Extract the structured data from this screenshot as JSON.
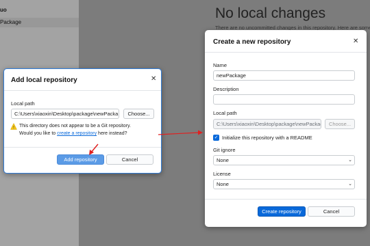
{
  "background": {
    "sidebar_top": "uo",
    "sidebar_item": "Package",
    "main_title": "No local changes",
    "main_subtitle": "There are no uncommitted changes in this repository. Here are some"
  },
  "add_local": {
    "title": "Add local repository",
    "local_path_label": "Local path",
    "local_path_value": "C:\\Users\\xiaoxin\\Desktop\\package\\newPacka",
    "choose_label": "Choose...",
    "warning_line1": "This directory does not appear to be a Git repository.",
    "warning_line2_prefix": "Would you like to ",
    "warning_link": "create a repository",
    "warning_line2_suffix": " here instead?",
    "add_button": "Add repository",
    "cancel_button": "Cancel"
  },
  "create_new": {
    "title": "Create a new repository",
    "name_label": "Name",
    "name_value": "newPackage",
    "description_label": "Description",
    "description_value": "",
    "local_path_label": "Local path",
    "local_path_value": "C:\\Users\\xiaoxin\\Desktop\\package\\newPackage",
    "choose_label": "Choose...",
    "readme_label": "Initialize this repository with a README",
    "readme_checked": true,
    "gitignore_label": "Git ignore",
    "gitignore_value": "None",
    "license_label": "License",
    "license_value": "None",
    "create_button": "Create repository",
    "cancel_button": "Cancel"
  },
  "colors": {
    "accent": "#0969da",
    "annotation": "#e02020"
  }
}
